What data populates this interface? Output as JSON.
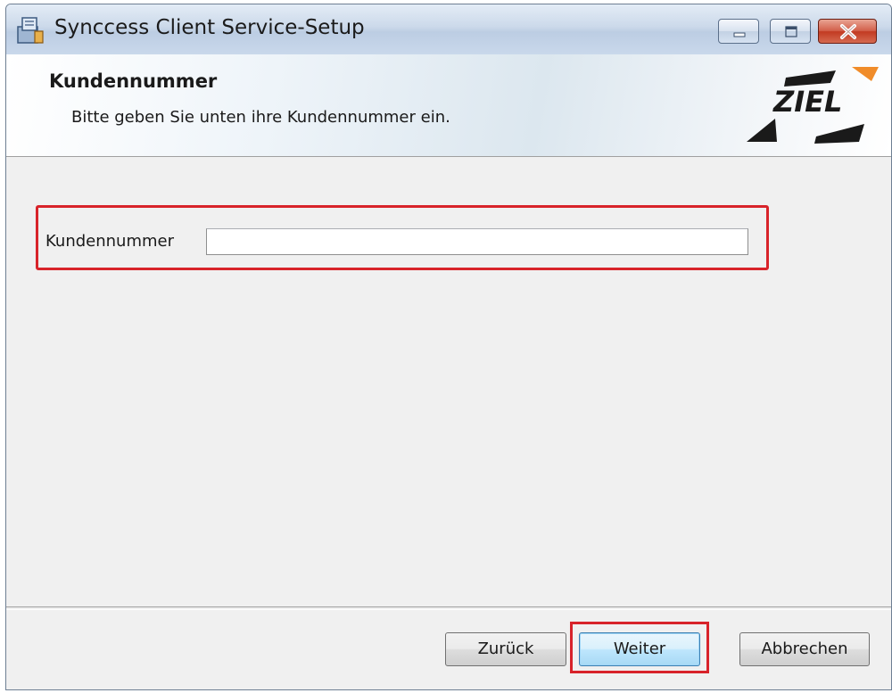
{
  "window": {
    "title": "Synccess Client Service-Setup",
    "controls": {
      "minimize": "minimize-icon",
      "maximize": "maximize-icon",
      "close": "close-icon"
    }
  },
  "header": {
    "title": "Kundennummer",
    "subtitle": "Bitte geben Sie unten ihre Kundennummer ein.",
    "logo_text": "ZIEL"
  },
  "form": {
    "customer_number_label": "Kundennummer",
    "customer_number_value": "",
    "highlight_color": "#d8232a"
  },
  "buttons": {
    "back": "Zurück",
    "next": "Weiter",
    "cancel": "Abbrechen"
  }
}
